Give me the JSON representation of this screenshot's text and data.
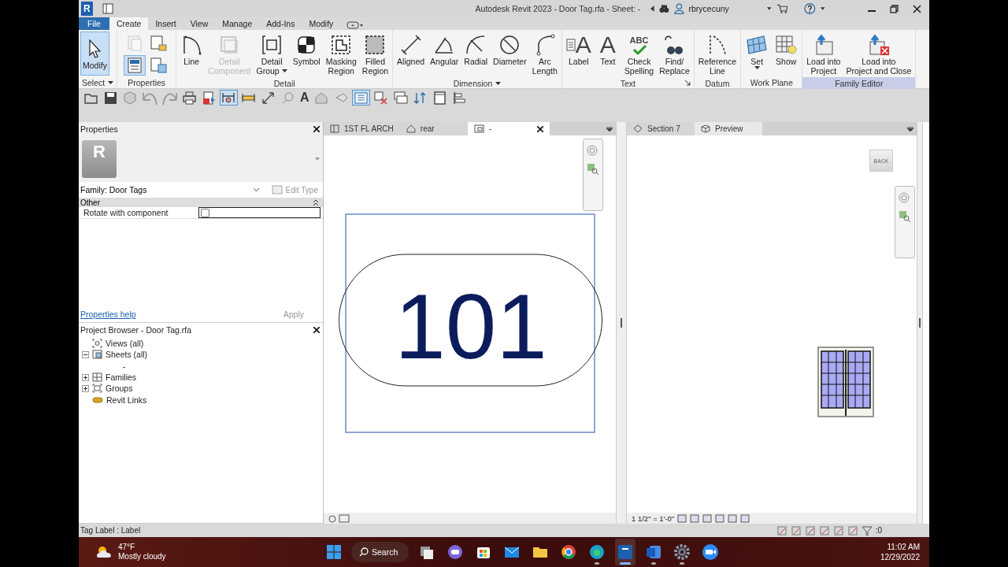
{
  "window": {
    "logo": "R",
    "title": "Autodesk Revit 2023 - Door Tag.rfa - Sheet: -",
    "user": "rbrycecuny"
  },
  "menu_tabs": [
    {
      "label": "File",
      "kind": "file",
      "selected": false
    },
    {
      "label": "Create",
      "kind": "tab",
      "selected": true
    },
    {
      "label": "Insert",
      "kind": "tab",
      "selected": false
    },
    {
      "label": "View",
      "kind": "tab",
      "selected": false
    },
    {
      "label": "Manage",
      "kind": "tab",
      "selected": false
    },
    {
      "label": "Add-Ins",
      "kind": "tab",
      "selected": false
    },
    {
      "label": "Modify",
      "kind": "tab",
      "selected": false
    }
  ],
  "ribbon_groups": [
    {
      "label": "Select",
      "dropdown": true,
      "buttons": [
        {
          "lines": [
            "Modify"
          ],
          "selected": true,
          "disabled": false
        }
      ]
    },
    {
      "label": "Properties",
      "tools": [
        {
          "selected": false,
          "disabled": true
        },
        {
          "selected": false,
          "disabled": false
        },
        {
          "selected": true,
          "disabled": false
        },
        {
          "selected": false,
          "disabled": false
        }
      ]
    },
    {
      "label": "Detail",
      "buttons": [
        {
          "lines": [
            "Line"
          ],
          "selected": false,
          "disabled": false
        },
        {
          "lines": [
            "Detail",
            "Component"
          ],
          "selected": false,
          "disabled": true
        },
        {
          "lines": [
            "Detail",
            "Group"
          ],
          "selected": false,
          "disabled": false,
          "dropdown": true
        },
        {
          "lines": [
            "Symbol"
          ],
          "selected": false,
          "disabled": false
        },
        {
          "lines": [
            "Masking",
            "Region"
          ],
          "selected": false,
          "disabled": false
        },
        {
          "lines": [
            "Filled",
            "Region"
          ],
          "selected": false,
          "disabled": false
        }
      ]
    },
    {
      "label": "Dimension",
      "dropdown": true,
      "buttons": [
        {
          "lines": [
            "Aligned"
          ],
          "selected": false,
          "disabled": false
        },
        {
          "lines": [
            "Angular"
          ],
          "selected": false,
          "disabled": false
        },
        {
          "lines": [
            "Radial"
          ],
          "selected": false,
          "disabled": false
        },
        {
          "lines": [
            "Diameter"
          ],
          "selected": false,
          "disabled": false
        },
        {
          "lines": [
            "Arc",
            "Length"
          ],
          "selected": false,
          "disabled": false
        }
      ]
    },
    {
      "label": "Text",
      "launcher": true,
      "buttons": [
        {
          "lines": [
            "Label"
          ],
          "glyph": "A",
          "selected": false,
          "disabled": false
        },
        {
          "lines": [
            "Text"
          ],
          "glyph": "A",
          "selected": false,
          "disabled": false
        },
        {
          "lines": [
            "Check",
            "Spelling"
          ],
          "glyph": "ABC",
          "selected": false,
          "disabled": false
        },
        {
          "lines": [
            "Find/",
            "Replace"
          ],
          "selected": false,
          "disabled": false
        }
      ]
    },
    {
      "label": "Datum",
      "buttons": [
        {
          "lines": [
            "Reference",
            "Line"
          ],
          "selected": false,
          "disabled": false
        }
      ]
    },
    {
      "label": "Work Plane",
      "buttons": [
        {
          "lines": [
            "Set"
          ],
          "selected": false,
          "disabled": false,
          "dropdown": true
        },
        {
          "lines": [
            "Show"
          ],
          "selected": false,
          "disabled": false
        }
      ]
    },
    {
      "label": "Family Editor",
      "highlighted": true,
      "buttons": [
        {
          "lines": [
            "Load into",
            "Project"
          ],
          "selected": false,
          "disabled": false
        },
        {
          "lines": [
            "Load into",
            "Project and Close"
          ],
          "selected": false,
          "disabled": false
        }
      ]
    }
  ],
  "quick_access": [
    {
      "selected": false
    },
    {
      "selected": false
    },
    {
      "selected": false
    },
    {
      "selected": false
    },
    {
      "selected": false
    },
    {
      "selected": false
    },
    {
      "selected": false
    },
    {
      "selected": true
    },
    {
      "selected": false
    },
    {
      "selected": false
    },
    {
      "selected": false
    },
    {
      "selected": false,
      "glyph": "A"
    },
    {
      "selected": false
    },
    {
      "selected": false
    },
    {
      "selected": true
    },
    {
      "selected": false
    },
    {
      "selected": false
    },
    {
      "selected": false
    },
    {
      "selected": false
    },
    {
      "selected": false
    }
  ],
  "properties": {
    "title": "Properties",
    "type_image_letter": "R",
    "type_selector": "Family: Door Tags",
    "edit_type": {
      "label": "Edit Type",
      "disabled": true
    },
    "sections": [
      {
        "label": "Other",
        "expanded": true,
        "rows": [
          {
            "label": "Rotate with component",
            "checked": false
          }
        ]
      }
    ],
    "help_link": "Properties help",
    "apply": {
      "label": "Apply",
      "disabled": true
    }
  },
  "project_browser": {
    "title": "Project Browser - Door Tag.rfa",
    "tree": [
      {
        "label": "Views (all)",
        "kind": "views"
      },
      {
        "label": "Sheets (all)",
        "kind": "sheets",
        "expanded": true,
        "children": [
          {
            "label": "-"
          }
        ]
      },
      {
        "label": "Families",
        "kind": "families",
        "expanded": false
      },
      {
        "label": "Groups",
        "kind": "groups",
        "expanded": false
      },
      {
        "label": "Revit Links",
        "kind": "links"
      }
    ]
  },
  "view_panes": [
    {
      "tabs": [
        {
          "label": "1ST FL ARCH",
          "kind": "plan",
          "selected": false
        },
        {
          "label": "rear",
          "kind": "elevation",
          "selected": false
        },
        {
          "label": "-",
          "kind": "sheet",
          "selected": true
        }
      ],
      "tag_text": "101"
    },
    {
      "tabs": [
        {
          "label": "Section 7",
          "kind": "section",
          "selected": false
        },
        {
          "label": "Preview",
          "kind": "preview",
          "selected": true
        }
      ],
      "viewcube": "BACK",
      "scale": "1 1/2\" = 1'-0\""
    }
  ],
  "status_bar": {
    "text": "Tag Label : Label",
    "filter_count": ":0"
  },
  "taskbar": {
    "weather": {
      "temp": "47°F",
      "condition": "Mostly cloudy"
    },
    "search": "Search",
    "apps": [
      {
        "running": false,
        "active": false
      },
      {
        "running": false,
        "active": false
      },
      {
        "running": false,
        "active": false
      },
      {
        "running": false,
        "active": false
      },
      {
        "running": false,
        "active": false
      },
      {
        "running": false,
        "active": false
      },
      {
        "running": true,
        "active": false
      },
      {
        "running": true,
        "active": true
      },
      {
        "running": true,
        "active": false
      },
      {
        "running": true,
        "active": false
      },
      {
        "running": false,
        "active": false
      }
    ],
    "time": "11:02 AM",
    "date": "12/29/2022"
  }
}
